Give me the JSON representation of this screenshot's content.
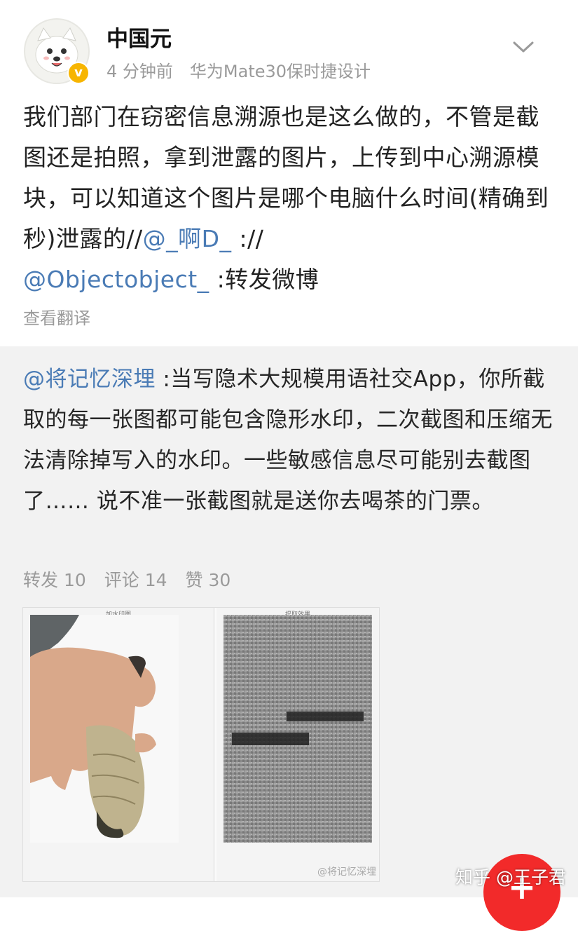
{
  "post": {
    "username": "中国元",
    "time": "4 分钟前",
    "device": "华为Mate30保时捷设计",
    "body_text": "我们部门在窃密信息溯源也是这么做的，不管是截图还是拍照，拿到泄露的图片，上传到中心溯源模块，可以知道这个图片是哪个电脑什么时间(精确到秒)泄露的//",
    "mention_1": "@_啊D_",
    "separator": " ://",
    "mention_2": "@Objectobject_",
    "body_tail": " :转发微博",
    "translate_label": "查看翻译"
  },
  "repost": {
    "author_mention": "@将记忆深埋",
    "text": " :当写隐术大规模用语社交App，你所截取的每一张图都可能包含隐形水印，二次截图和压缩无法清除掉写入的水印。一些敏感信息尽可能别去截图了…… 说不准一张截图就是送你去喝茶的门票。",
    "stats": {
      "reposts": "转发 10",
      "comments": "评论 14",
      "likes": "赞 30"
    },
    "image": {
      "left_caption": "加水印图",
      "right_caption": "提取效果",
      "image_watermark": "@将记忆深埋"
    }
  },
  "site_watermark": "知乎 @王子君",
  "icons": {
    "chevron": "chevron-down-icon",
    "badge": "verified-badge-icon",
    "fab": "plus-icon"
  },
  "colors": {
    "mention": "#4a7bb5",
    "secondary_text": "#9a9a9a",
    "card_background": "#f2f2f2",
    "verified": "#f7b500",
    "fab": "#f22a2a"
  }
}
